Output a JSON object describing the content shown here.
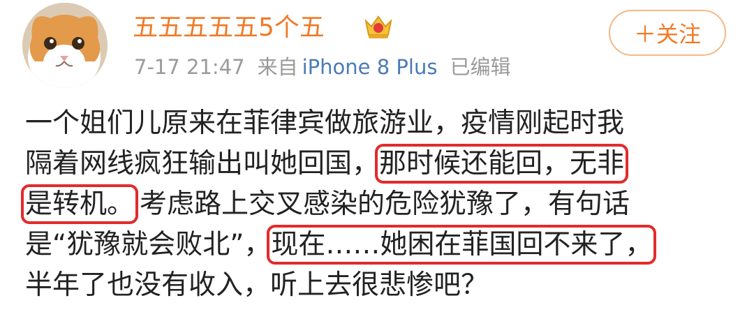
{
  "user": {
    "name": "五五五五五5个五",
    "avatar_icon": "cat-avatar",
    "vip_icon": "crown-badge-icon"
  },
  "follow_button": {
    "label": "＋关注"
  },
  "meta": {
    "timestamp": "7-17 21:47",
    "source_prefix": "来自",
    "device": "iPhone 8 Plus",
    "edited": "已编辑"
  },
  "post": {
    "line1": "一个姐们儿原来在菲律宾做旅游业，疫情刚起时我",
    "line2_a": "隔着网线疯狂输出叫她回国，",
    "line2_b": "那时候还能回，无非",
    "line3_a": "是转机。",
    "line3_b": "考虑路上交叉感染的危险犹豫了，有句话",
    "line4_a": "是“犹豫就会败北”，",
    "line4_b": "现在……她困在菲国回不来了，",
    "line5": "半年了也没有收入，听上去很悲惨吧？"
  },
  "colors": {
    "username": "#f07a27",
    "device": "#4a7bb5",
    "highlight_box": "#e22b2b",
    "follow_border": "#f5b985"
  }
}
